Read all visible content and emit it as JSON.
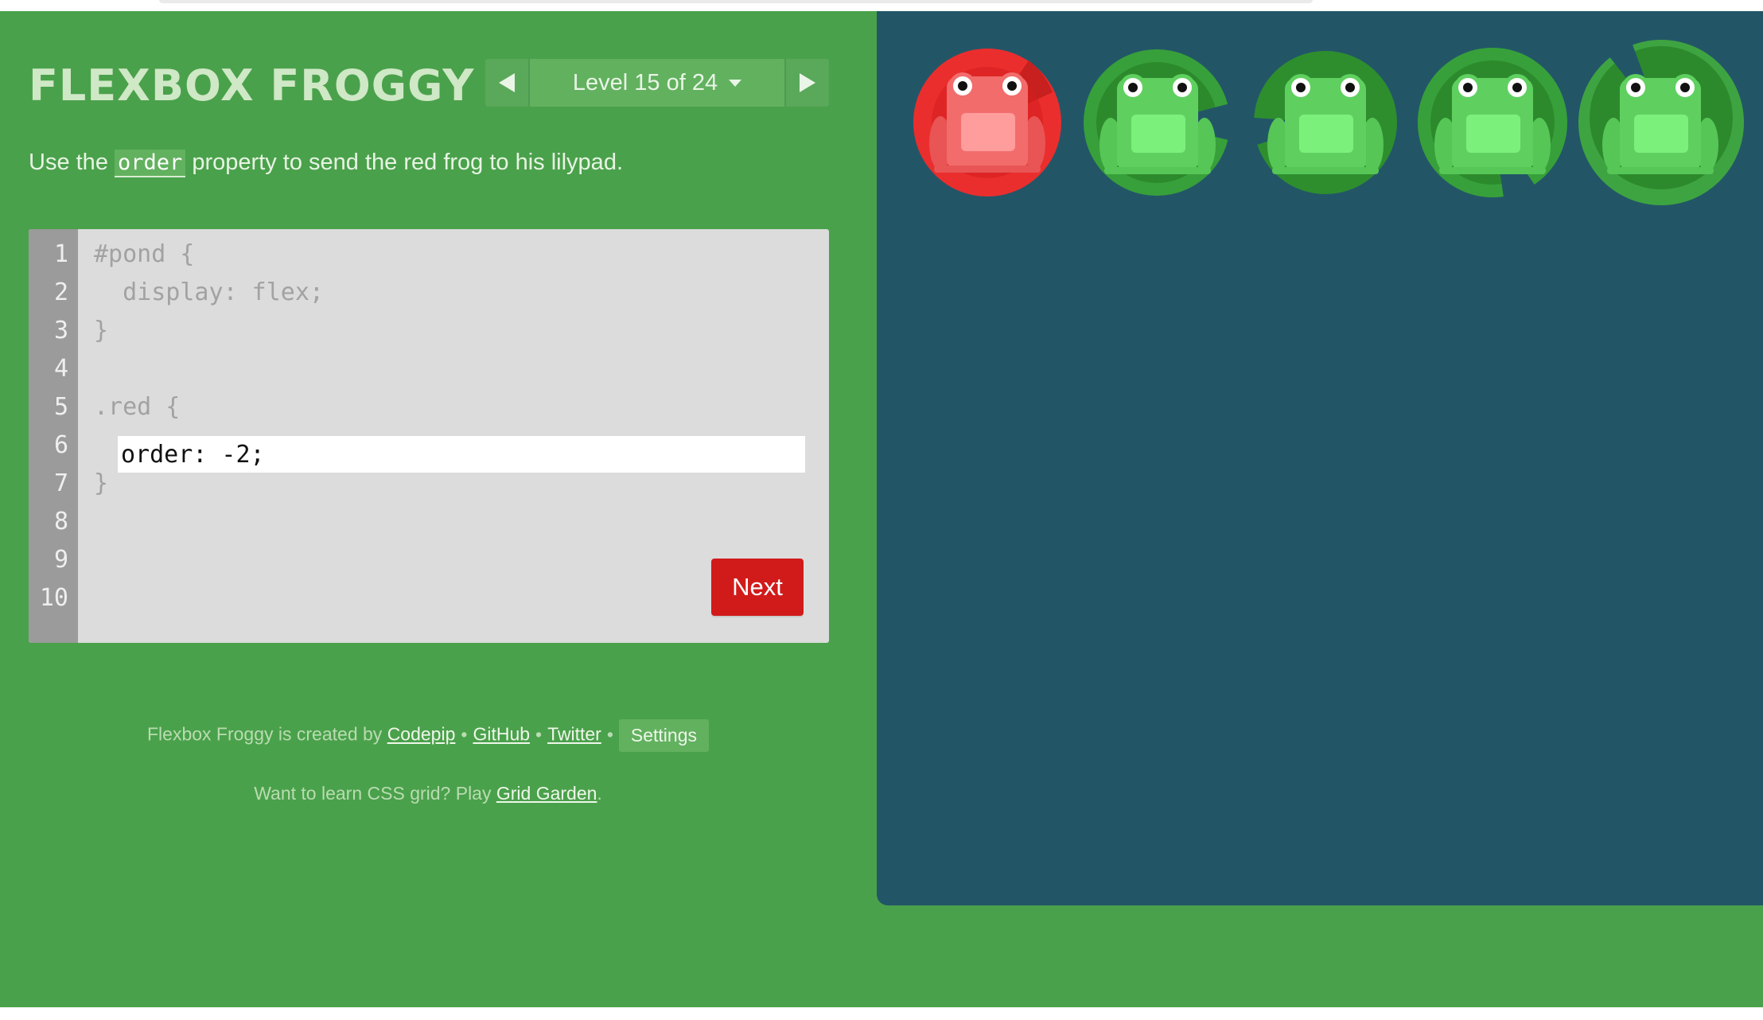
{
  "header": {
    "title": "FLEXBOX FROGGY",
    "level_label": "Level 15 of 24"
  },
  "instructions": {
    "prefix": "Use the",
    "keyword": "order",
    "suffix": "property to send the red frog to his lilypad."
  },
  "editor": {
    "line_numbers": [
      "1",
      "2",
      "3",
      "4",
      "5",
      "6",
      "7",
      "8",
      "9",
      "10"
    ],
    "lines": [
      "#pond {",
      "  display: flex;",
      "}",
      "",
      ".red {",
      "",
      "}"
    ],
    "input_value": "order: -2;",
    "next_label": "Next"
  },
  "footer": {
    "credit_prefix": "Flexbox Froggy is created by",
    "codepip_link": "Codepip",
    "github_link": "GitHub",
    "twitter_link": "Twitter",
    "separator": "•",
    "settings_label": "Settings",
    "promo_prefix": "Want to learn CSS grid? Play",
    "promo_link": "Grid Garden",
    "promo_suffix": "."
  },
  "pond": {
    "items": [
      {
        "color": "red",
        "on_lilypad": "red"
      },
      {
        "color": "green",
        "on_lilypad": "green"
      },
      {
        "color": "green",
        "on_lilypad": "green"
      },
      {
        "color": "green",
        "on_lilypad": "green"
      },
      {
        "color": "green",
        "on_lilypad": "green"
      }
    ]
  },
  "colors": {
    "background": "#4aa14b",
    "pond": "#225667",
    "next_button": "#d11b1b",
    "red_lilypad": "#ea2e2e",
    "green_lilypad": "#2f8f2e",
    "red_frog": "#f06b6b",
    "green_frog": "#5ecf5e"
  }
}
